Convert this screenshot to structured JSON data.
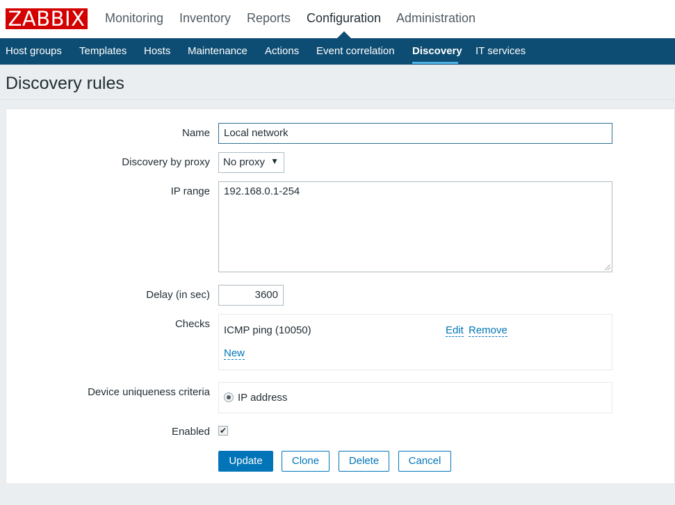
{
  "logo": "ZABBIX",
  "main_menu": [
    "Monitoring",
    "Inventory",
    "Reports",
    "Configuration",
    "Administration"
  ],
  "sub_menu": [
    "Host groups",
    "Templates",
    "Hosts",
    "Maintenance",
    "Actions",
    "Event correlation",
    "Discovery",
    "IT services"
  ],
  "page_title": "Discovery rules",
  "form": {
    "name_label": "Name",
    "name_value": "Local network",
    "proxy_label": "Discovery by proxy",
    "proxy_value": "No proxy",
    "ip_range_label": "IP range",
    "ip_range_value": "192.168.0.1-254",
    "delay_label": "Delay (in sec)",
    "delay_value": "3600",
    "checks_label": "Checks",
    "check_item": "ICMP ping (10050)",
    "edit_link": "Edit",
    "remove_link": "Remove",
    "new_link": "New",
    "uniqueness_label": "Device uniqueness criteria",
    "uniqueness_option": "IP address",
    "enabled_label": "Enabled",
    "enabled_checked": true
  },
  "buttons": {
    "update": "Update",
    "clone": "Clone",
    "delete": "Delete",
    "cancel": "Cancel"
  },
  "colors": {
    "brand": "#d40000",
    "nav": "#0e4d73",
    "accent": "#0275b8"
  },
  "icons": {
    "dropdown": "triangle-down",
    "checkbox": "checkmark",
    "radio": "radio-selected"
  }
}
